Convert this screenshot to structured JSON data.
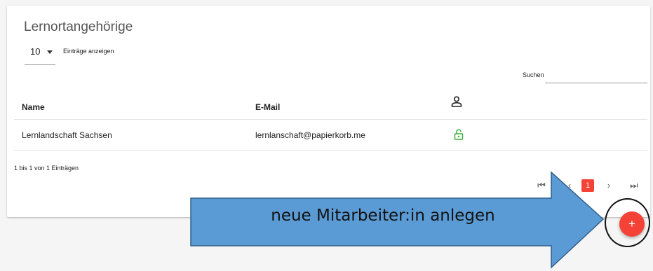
{
  "card": {
    "title": "Lernortangehörige"
  },
  "length": {
    "value": "10",
    "label": "Einträge anzeigen"
  },
  "search": {
    "label": "Suchen",
    "placeholder": ""
  },
  "table": {
    "columns": [
      "Name",
      "E-Mail"
    ],
    "rows": [
      {
        "name": "Lernlandschaft Sachsen",
        "email": "lernlanschaft@papierkorb.me"
      }
    ]
  },
  "info": "1 bis 1 von 1 Einträgen",
  "pagination": {
    "first": "⏮",
    "prev": "‹",
    "current": "1",
    "next": "›",
    "last": "⏭"
  },
  "fab": {
    "label": "+"
  },
  "annotation": {
    "text": "neue Mitarbeiter:in anlegen"
  },
  "colors": {
    "accent": "#f44336",
    "lock": "#3cae3a",
    "arrow": "#5b9bd5",
    "arrow_border": "#2e5f8a"
  },
  "icons": {
    "column_icon": "person-outline-icon",
    "row_icon": "unlock-icon"
  }
}
